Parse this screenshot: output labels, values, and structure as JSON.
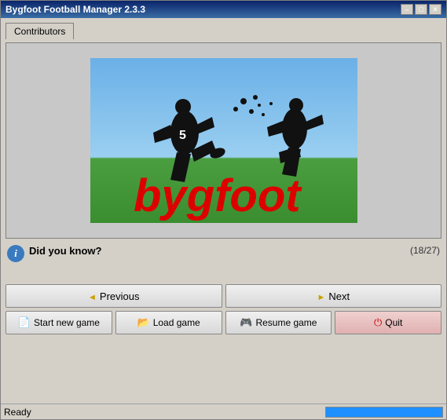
{
  "window": {
    "title": "Bygfoot Football Manager 2.3.3",
    "min_label": "–",
    "max_label": "□",
    "close_label": "✕"
  },
  "tabs": [
    {
      "label": "Contributors"
    }
  ],
  "logo": {
    "alt": "Bygfoot logo"
  },
  "did_you_know": {
    "label": "Did you know?",
    "counter": "(18/27)",
    "icon_label": "i"
  },
  "nav": {
    "previous_label": "Previous",
    "next_label": "Next"
  },
  "actions": {
    "new_game_label": "Start new game",
    "load_game_label": "Load game",
    "resume_game_label": "Resume game",
    "quit_label": "Quit"
  },
  "status": {
    "text": "Ready",
    "progress": 100
  }
}
